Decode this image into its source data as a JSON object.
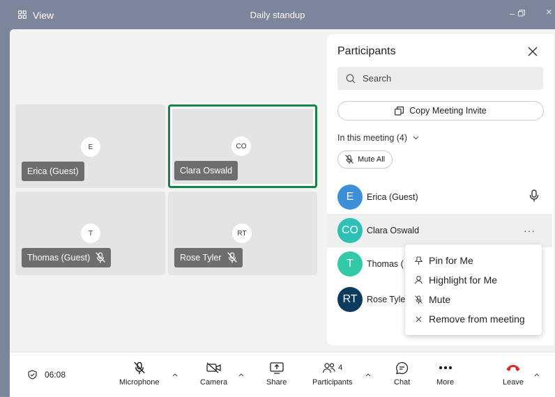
{
  "titlebar": {
    "view_label": "View",
    "title": "Daily standup",
    "minimize": "–",
    "restore": "▫",
    "close": "×"
  },
  "grid": {
    "tiles": [
      {
        "initials": "E",
        "name": "Erica (Guest)",
        "muted": false,
        "active": false
      },
      {
        "initials": "CO",
        "name": "Clara Oswald",
        "muted": false,
        "active": true
      },
      {
        "initials": "T",
        "name": "Thomas (Guest)",
        "muted": true,
        "active": false
      },
      {
        "initials": "RT",
        "name": "Rose Tyler",
        "muted": true,
        "active": false
      }
    ]
  },
  "panel": {
    "title": "Participants",
    "search_placeholder": "Search",
    "copy_invite": "Copy Meeting Invite",
    "section": "In this meeting (4)",
    "mute_all": "Mute All",
    "participants": [
      {
        "initials": "E",
        "name": "Erica (Guest)",
        "color": "#3d8fd8"
      },
      {
        "initials": "CO",
        "name": "Clara Oswald",
        "color": "#2fc0b5"
      },
      {
        "initials": "T",
        "name": "Thomas (",
        "color": "#34c9a6"
      },
      {
        "initials": "RT",
        "name": "Rose Tyle",
        "color": "#0c3b5e"
      }
    ],
    "row_more": "···"
  },
  "context_menu": {
    "items": [
      {
        "label": "Pin for Me",
        "icon": "pin-icon"
      },
      {
        "label": "Highlight for Me",
        "icon": "person-icon"
      },
      {
        "label": "Mute",
        "icon": "mic-off-icon"
      },
      {
        "label": "Remove from meeting",
        "icon": "close-icon"
      }
    ]
  },
  "toolbar": {
    "timer": "06:08",
    "microphone": "Microphone",
    "camera": "Camera",
    "share": "Share",
    "participants": "Participants",
    "participants_count": "4",
    "chat": "Chat",
    "more": "More",
    "leave": "Leave"
  },
  "colors": {
    "active_border": "#138643",
    "leave_red": "#d62b2b",
    "titlebar_bg": "#7c8599"
  }
}
